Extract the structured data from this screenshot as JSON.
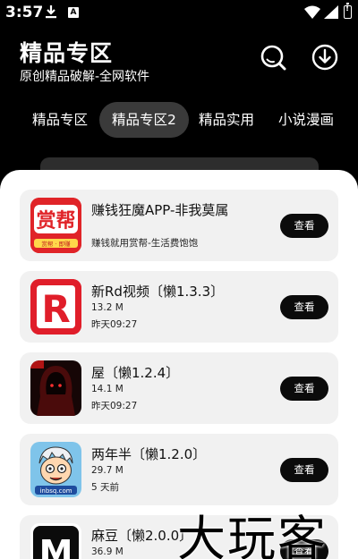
{
  "status_bar": {
    "time": "3:57",
    "notification_letter": "A"
  },
  "header": {
    "title": "精品专区",
    "subtitle": "原创精品破解-全网软件"
  },
  "tabs": [
    {
      "label": "精品专区",
      "active": false
    },
    {
      "label": "精品专区2",
      "active": true
    },
    {
      "label": "精品实用",
      "active": false
    },
    {
      "label": "小说漫画",
      "active": false
    }
  ],
  "apps": [
    {
      "name": "赚钱狂魔APP-非我莫属",
      "size": "",
      "time": "",
      "desc": "赚钱就用赏帮-生活费饱饱",
      "button": "查看",
      "icon": "shangbang-app-icon",
      "icon_text": "赏帮",
      "icon_subtext": "赏帮 · 即赚"
    },
    {
      "name": "新Rd视频〔懒1.3.3〕",
      "size": "13.2 M",
      "time": "昨天09:27",
      "desc": "",
      "button": "查看",
      "icon": "red-r-app-icon",
      "icon_text": "R"
    },
    {
      "name": "屋〔懒1.2.4〕",
      "size": "14.1 M",
      "time": "昨天09:27",
      "desc": "",
      "button": "查看",
      "icon": "hooded-figure-app-icon"
    },
    {
      "name": "两年半〔懒1.2.0〕",
      "size": "29.7 M",
      "time": "5 天前",
      "desc": "",
      "button": "查看",
      "icon": "cartoon-avatar-app-icon",
      "icon_text": "inbsq.com"
    },
    {
      "name": "麻豆〔懒2.0.0〕",
      "size": "36.9 M",
      "time": "",
      "desc": "",
      "button": "查看",
      "icon": "m-logo-app-icon",
      "icon_text": "M"
    }
  ],
  "watermark": "大玩客",
  "colors": {
    "background": "#000000",
    "sheet": "#ffffff",
    "card": "#f1f1f1",
    "button": "#0b0b0b",
    "active_tab": "#3a3a3a"
  }
}
